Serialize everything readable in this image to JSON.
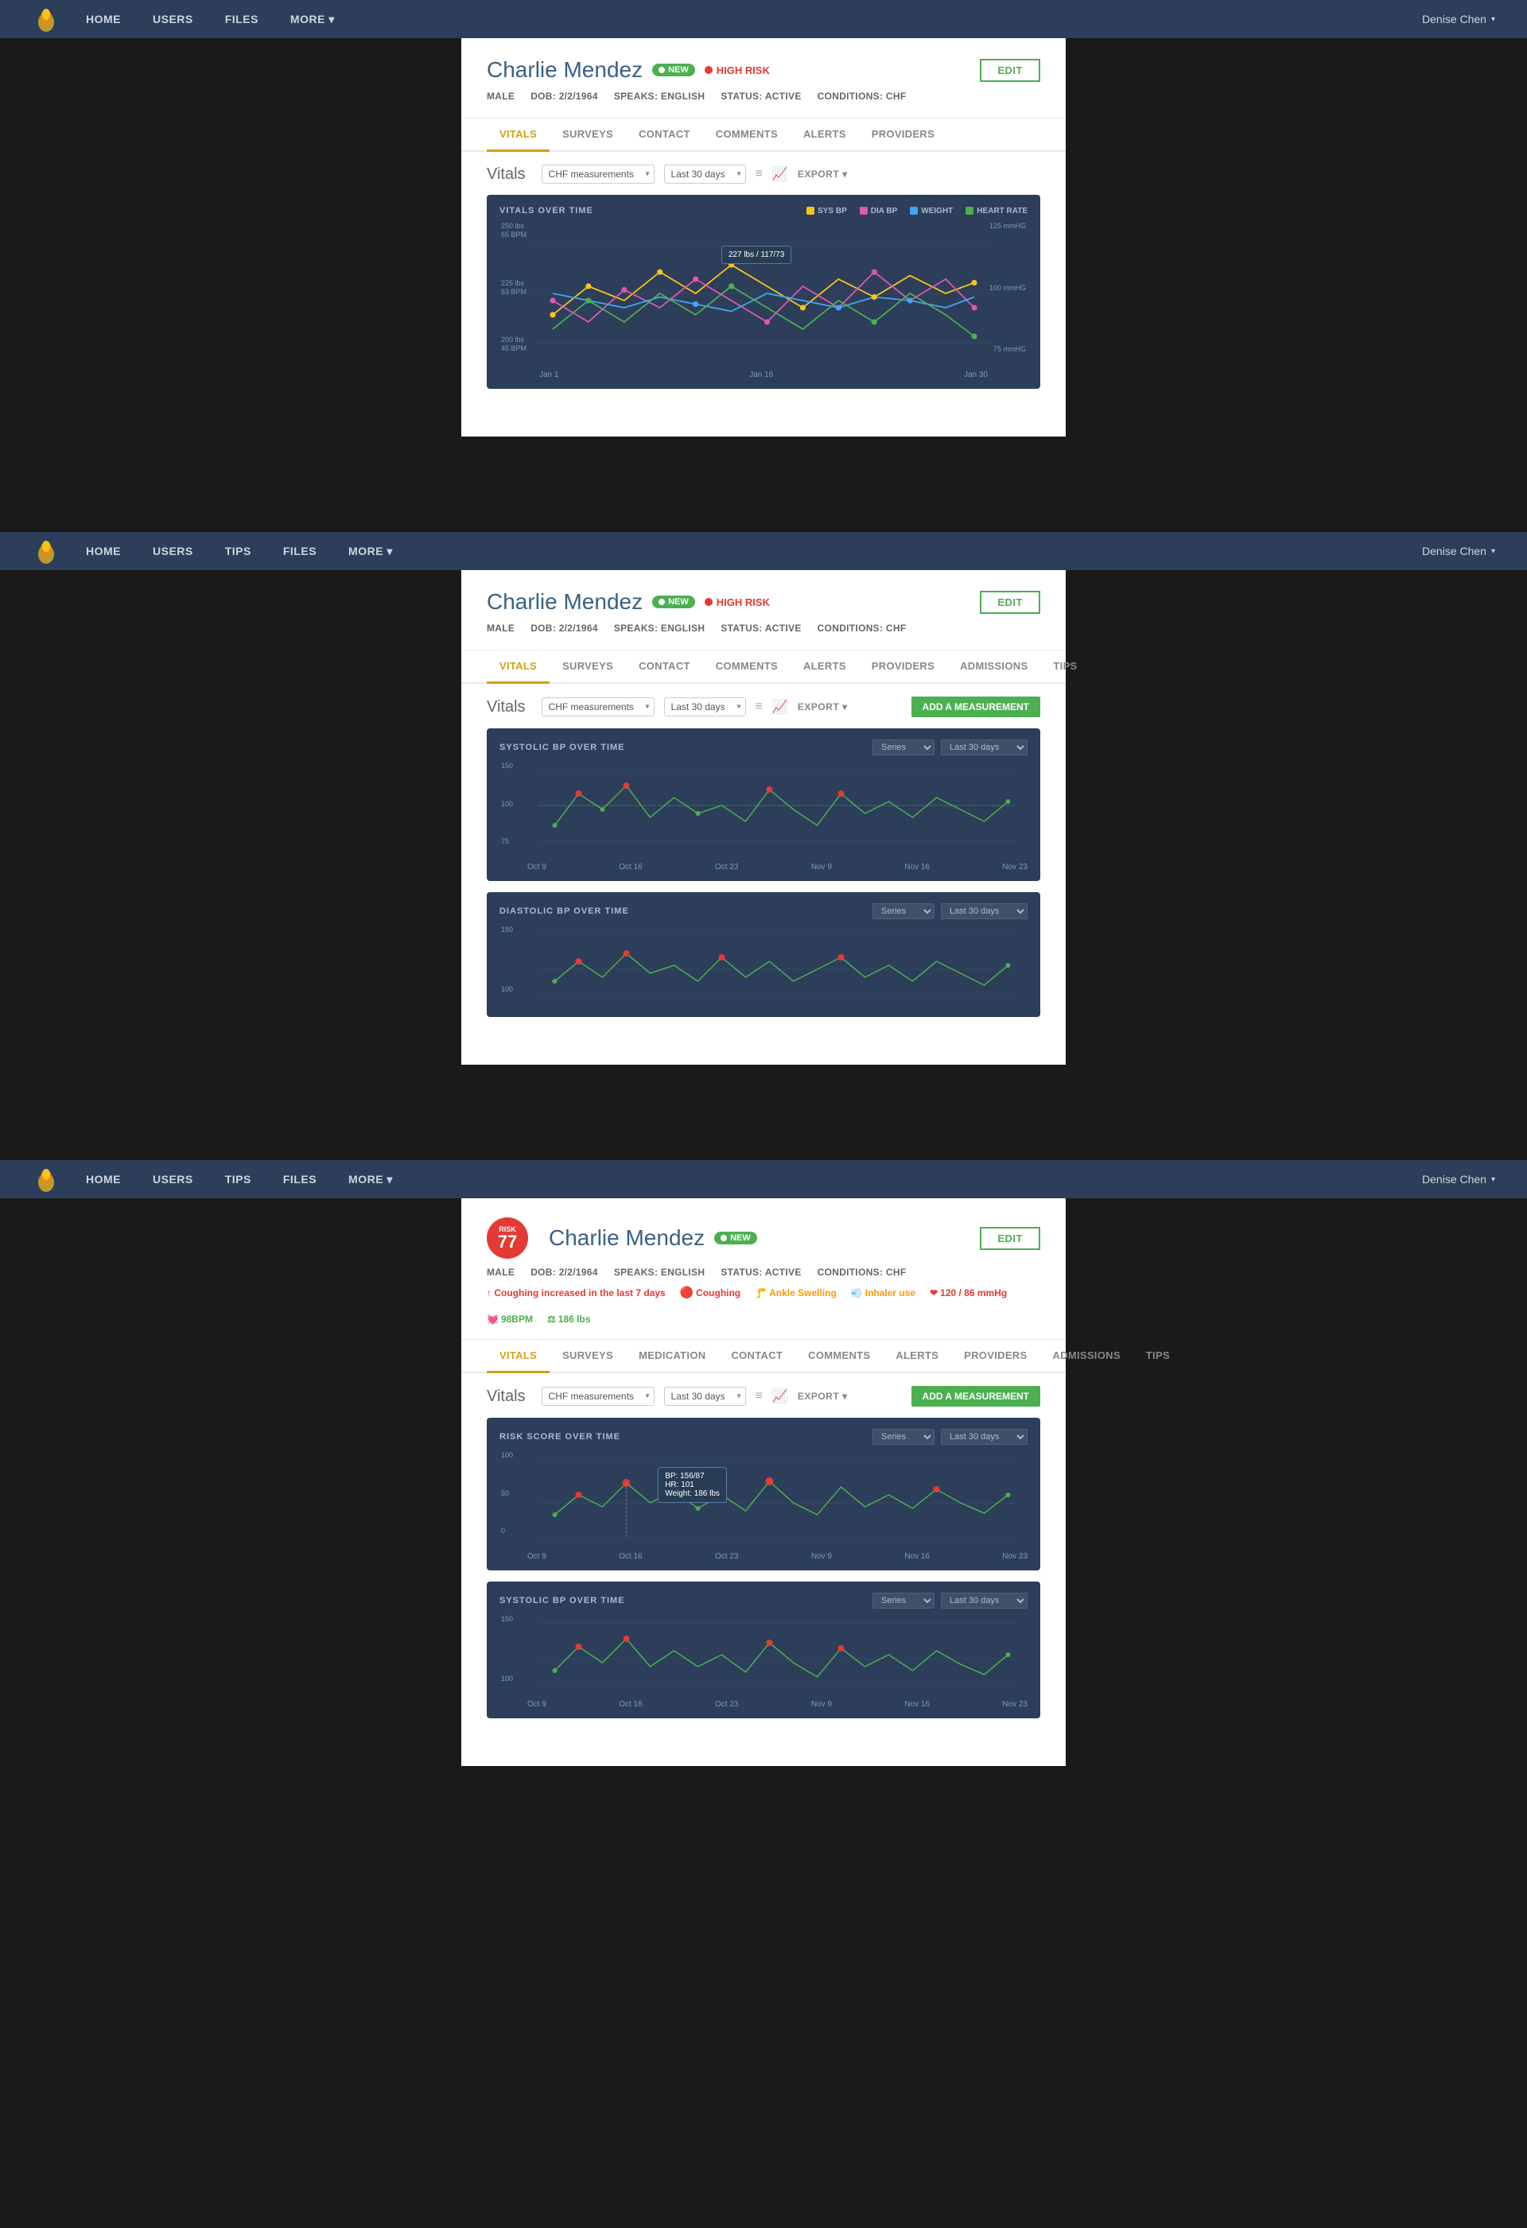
{
  "app": {
    "logo_alt": "App Logo",
    "user": "Denise Chen"
  },
  "nav1": {
    "links": [
      "HOME",
      "USERS",
      "FILES",
      "MORE ▾"
    ]
  },
  "nav2": {
    "links": [
      "HOME",
      "USERS",
      "TIPS",
      "FILES",
      "MORE ▾"
    ]
  },
  "patient": {
    "name": "Charlie Mendez",
    "badge_new": "NEW",
    "badge_high_risk": "HIGH RISK",
    "edit_label": "EDIT",
    "meta": {
      "gender": "MALE",
      "dob": "DOB: 2/2/1964",
      "language": "SPEAKS: ENGLISH",
      "status": "STATUS: ACTIVE",
      "conditions": "CONDITIONS: CHF"
    }
  },
  "section1": {
    "tabs": [
      "VITALS",
      "SURVEYS",
      "CONTACT",
      "COMMENTS",
      "ALERTS",
      "PROVIDERS"
    ],
    "active_tab": "VITALS",
    "vitals_title": "Vitals",
    "measurements_select": "CHF measurements",
    "days_select": "Last 30 days",
    "export_label": "EXPORT",
    "chart_title": "VITALS OVER TIME",
    "legend": [
      {
        "label": "SYS BP",
        "color": "#f5c518"
      },
      {
        "label": "DIA BP",
        "color": "#e056b0"
      },
      {
        "label": "WEIGHT",
        "color": "#42a5f5"
      },
      {
        "label": "HEART RATE",
        "color": "#4caf50"
      }
    ],
    "x_labels": [
      "Jan 1",
      "Jan 16",
      "Jan 30"
    ],
    "y_right_labels": [
      "125 mmHG",
      "100 mmHG",
      "75 mmHG"
    ],
    "y_left_labels": [
      "250 lbs\n65 BPM",
      "225 lbs\n53 BPM",
      "200 lbs\n45 BPM"
    ],
    "tooltip": {
      "line1": "227 lbs / 117/73",
      "line2": ""
    }
  },
  "section2": {
    "tabs": [
      "VITALS",
      "SURVEYS",
      "CONTACT",
      "COMMENTS",
      "ALERTS",
      "PROVIDERS",
      "ADMISSIONS",
      "TIPS"
    ],
    "active_tab": "VITALS",
    "vitals_title": "Vitals",
    "measurements_select": "CHF measurements",
    "days_select": "Last 30 days",
    "export_label": "EXPORT",
    "add_measurement_label": "ADD A MEASUREMENT",
    "chart1_title": "SYSTOLIC BP OVER TIME",
    "chart2_title": "DIASTOLIC BP OVER TIME",
    "series_select": "Series",
    "period_select": "Last 30 days",
    "x_labels": [
      "Oct 9",
      "Oct 16",
      "Oct 23",
      "Nov 9",
      "Nov 16",
      "Nov 23"
    ],
    "y_labels": [
      "150",
      "100",
      "75"
    ]
  },
  "section3": {
    "risk_score": "77",
    "risk_label": "RISK",
    "tabs": [
      "VITALS",
      "SURVEYS",
      "MEDICATION",
      "CONTACT",
      "COMMENTS",
      "ALERTS",
      "PROVIDERS",
      "ADMISSIONS",
      "TIPS"
    ],
    "active_tab": "VITALS",
    "vitals_title": "Vitals",
    "measurements_select": "CHF measurements",
    "days_select": "Last 30 days",
    "export_label": "EXPORT",
    "add_measurement_label": "ADD A MEASUREMENT",
    "alert_text": "↑ Coughing increased in the last 7 days",
    "alerts": [
      {
        "icon": "↑",
        "text": "Coughing increased in the last 7 days",
        "color": "#e53935"
      },
      {
        "icon": "🔴",
        "text": "Coughing",
        "color": "#e53935"
      },
      {
        "icon": "🦵",
        "text": "Ankle Swelling",
        "color": "#ff9800"
      },
      {
        "icon": "💨",
        "text": "Inhaler use",
        "color": "#ff9800"
      },
      {
        "icon": "❤",
        "text": "120 / 86 mmHg",
        "color": "#e53935"
      },
      {
        "icon": "💓",
        "text": "98BPM",
        "color": "#4caf50"
      },
      {
        "icon": "⚖",
        "text": "186 lbs",
        "color": "#4caf50"
      }
    ],
    "chart1_title": "RISK SCORE OVER TIME",
    "chart2_title": "SYSTOLIC BP OVER TIME",
    "series_select": "Series",
    "period_select": "Last 30 days",
    "x_labels": [
      "Oct 9",
      "Oct 16",
      "Oct 23",
      "Nov 9",
      "Nov 16",
      "Nov 23"
    ],
    "y_labels": [
      "100",
      "50",
      "0"
    ],
    "tooltip": {
      "bp": "BP: 156/87",
      "hr": "HR: 101",
      "weight": "Weight: 186 lbs"
    }
  }
}
